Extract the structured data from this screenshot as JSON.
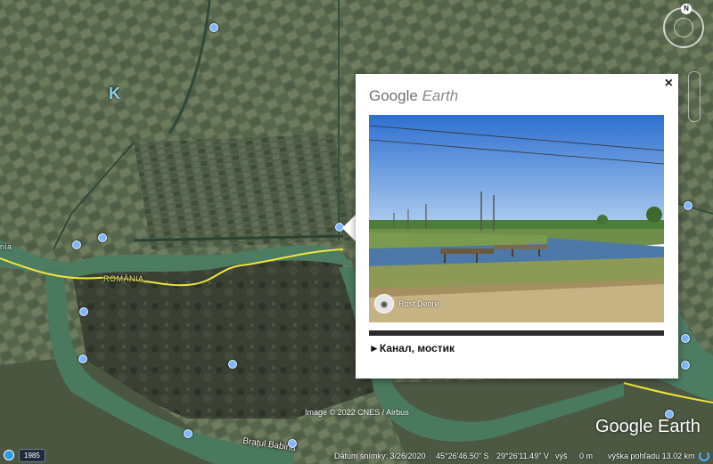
{
  "map": {
    "region_letter": "K",
    "country_label": "ROMÂNIA",
    "river_label": "Brațul Babina",
    "image_credit": "Image © 2022 CNES / Airbus",
    "left_edge_label": "nia"
  },
  "popup": {
    "brand_google": "Google",
    "brand_earth": "Earth",
    "close_label": "×",
    "photo_credit": "Rost Deore",
    "caption": "►Канал, мостик"
  },
  "compass": {
    "north_label": "N"
  },
  "watermark": "Google Earth",
  "status": {
    "year": "1985",
    "date": "Dátum snímky: 3/26/2020",
    "lat": "45°26'46.50\" S",
    "lon": "29°26'11.49\" V",
    "elev_label": "výš",
    "elev_value": "0 m",
    "eye_alt": "výška pohľadu  13.02 km"
  },
  "colors": {
    "river": "#4a7a5e",
    "border_line": "#f0e63c",
    "pin": "#7fb6ff"
  }
}
